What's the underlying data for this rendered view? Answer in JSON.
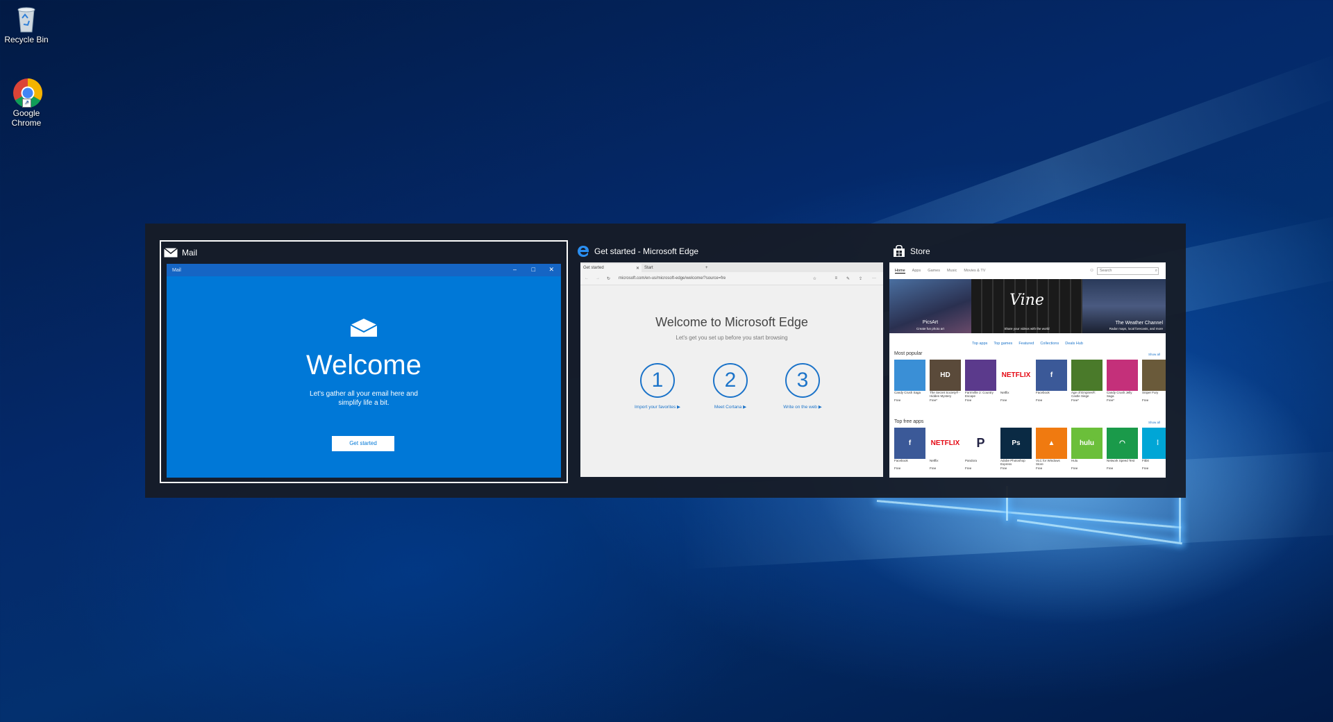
{
  "desktop": {
    "icons": [
      {
        "label": "Recycle Bin",
        "icon": "recycle-bin-icon"
      },
      {
        "label_line1": "Google",
        "label_line2": "Chrome",
        "icon": "chrome-icon"
      }
    ]
  },
  "switcher": {
    "mail": {
      "title": "Mail",
      "icon": "mail-icon",
      "window_title": "Mail",
      "heading": "Welcome",
      "subtitle_line1": "Let's gather all your email here and",
      "subtitle_line2": "simplify life a bit.",
      "button": "Get started"
    },
    "edge": {
      "title": "Get started - Microsoft Edge",
      "icon": "edge-icon",
      "tab1": "Get started",
      "tab2": "Start",
      "address": "microsoft.com/en-us/microsoft-edge/welcome/?source=fre",
      "heading": "Welcome to Microsoft Edge",
      "subtitle": "Let's get you set up before you start browsing",
      "steps": [
        {
          "num": "1",
          "label": "Import your favorites ▶"
        },
        {
          "num": "2",
          "label": "Meet Cortana ▶"
        },
        {
          "num": "3",
          "label": "Write on the web ▶"
        }
      ]
    },
    "store": {
      "title": "Store",
      "icon": "store-icon",
      "nav": [
        "Home",
        "Apps",
        "Games",
        "Music",
        "Movies & TV"
      ],
      "search_placeholder": "Search",
      "hero": [
        {
          "title": "PicsArt",
          "caption": "Create fun photo art"
        },
        {
          "title": "Vine",
          "caption": "Share your videos with the world"
        },
        {
          "title": "The Weather Channel",
          "caption": "Radar maps, local forecasts, and more"
        }
      ],
      "links": [
        "Top apps",
        "Top games",
        "Featured",
        "Collections",
        "Deals Hub"
      ],
      "most_popular": "Most popular",
      "top_free": "Top free apps",
      "show_all": "Show all",
      "popular_apps": [
        {
          "name": "Candy Crush Saga",
          "price": "Free",
          "color": "#3a8fd6",
          "label": ""
        },
        {
          "name": "The Secret Society® - Hidden Mystery",
          "price": "Free*",
          "color": "#5a4a3a",
          "label": "HD"
        },
        {
          "name": "FarmVille 2: Country Escape",
          "price": "Free",
          "color": "#5b3a8c",
          "label": ""
        },
        {
          "name": "Netflix",
          "price": "Free",
          "color": "#ffffff",
          "label": "NETFLIX"
        },
        {
          "name": "Facebook",
          "price": "Free",
          "color": "#3b5998",
          "label": "f"
        },
        {
          "name": "Age of Empires®: Castle Siege",
          "price": "Free*",
          "color": "#4a7a2a",
          "label": ""
        },
        {
          "name": "Candy Crush Jelly Saga",
          "price": "Free*",
          "color": "#c4307a",
          "label": ""
        },
        {
          "name": "Sniper Fury",
          "price": "Free",
          "color": "#6a5a3a",
          "label": ""
        }
      ],
      "free_apps": [
        {
          "name": "Facebook",
          "price": "Free",
          "color": "#3b5998",
          "label": "f"
        },
        {
          "name": "Netflix",
          "price": "Free",
          "color": "#ffffff",
          "label": "NETFLIX"
        },
        {
          "name": "Pandora",
          "price": "Free",
          "color": "#ffffff",
          "label": "P"
        },
        {
          "name": "Adobe Photoshop Express",
          "price": "Free",
          "color": "#0a2a44",
          "label": "Ps"
        },
        {
          "name": "VLC for Windows Store",
          "price": "Free",
          "color": "#f07a10",
          "label": "▲"
        },
        {
          "name": "Hulu",
          "price": "Free",
          "color": "#6bbf3a",
          "label": "hulu"
        },
        {
          "name": "Network Speed Test",
          "price": "Free",
          "color": "#1a9a4a",
          "label": "◠"
        },
        {
          "name": "Fitbit",
          "price": "Free",
          "color": "#00a6d6",
          "label": "⁞"
        }
      ]
    }
  }
}
